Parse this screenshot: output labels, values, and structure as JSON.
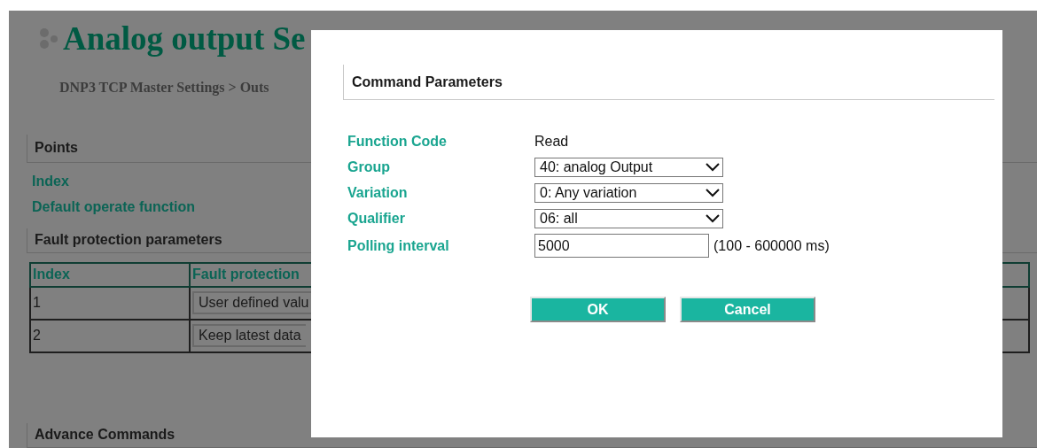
{
  "page": {
    "title": "Analog output Se",
    "breadcrumb": "DNP3 TCP Master Settings > Outs",
    "points": {
      "heading": "Points",
      "fields": [
        "Index",
        "Default operate function"
      ]
    },
    "fault_protection": {
      "heading": "Fault protection parameters",
      "columns": [
        "Index",
        "Fault protection"
      ],
      "rows": [
        {
          "index": "1",
          "value": "User defined valu"
        },
        {
          "index": "2",
          "value": "Keep latest data"
        }
      ]
    },
    "advance_heading": "Advance Commands"
  },
  "dialog": {
    "title": "Command Parameters",
    "fields": [
      {
        "kind": "text",
        "label": "Function Code",
        "value": "Read"
      },
      {
        "kind": "select",
        "label": "Group",
        "value": "40: analog Output"
      },
      {
        "kind": "select",
        "label": "Variation",
        "value": "0: Any variation"
      },
      {
        "kind": "select",
        "label": "Qualifier",
        "value": "06: all"
      },
      {
        "kind": "input",
        "label": "Polling interval",
        "value": "5000",
        "hint": "(100 - 600000 ms)"
      }
    ],
    "buttons": [
      "OK",
      "Cancel"
    ]
  }
}
